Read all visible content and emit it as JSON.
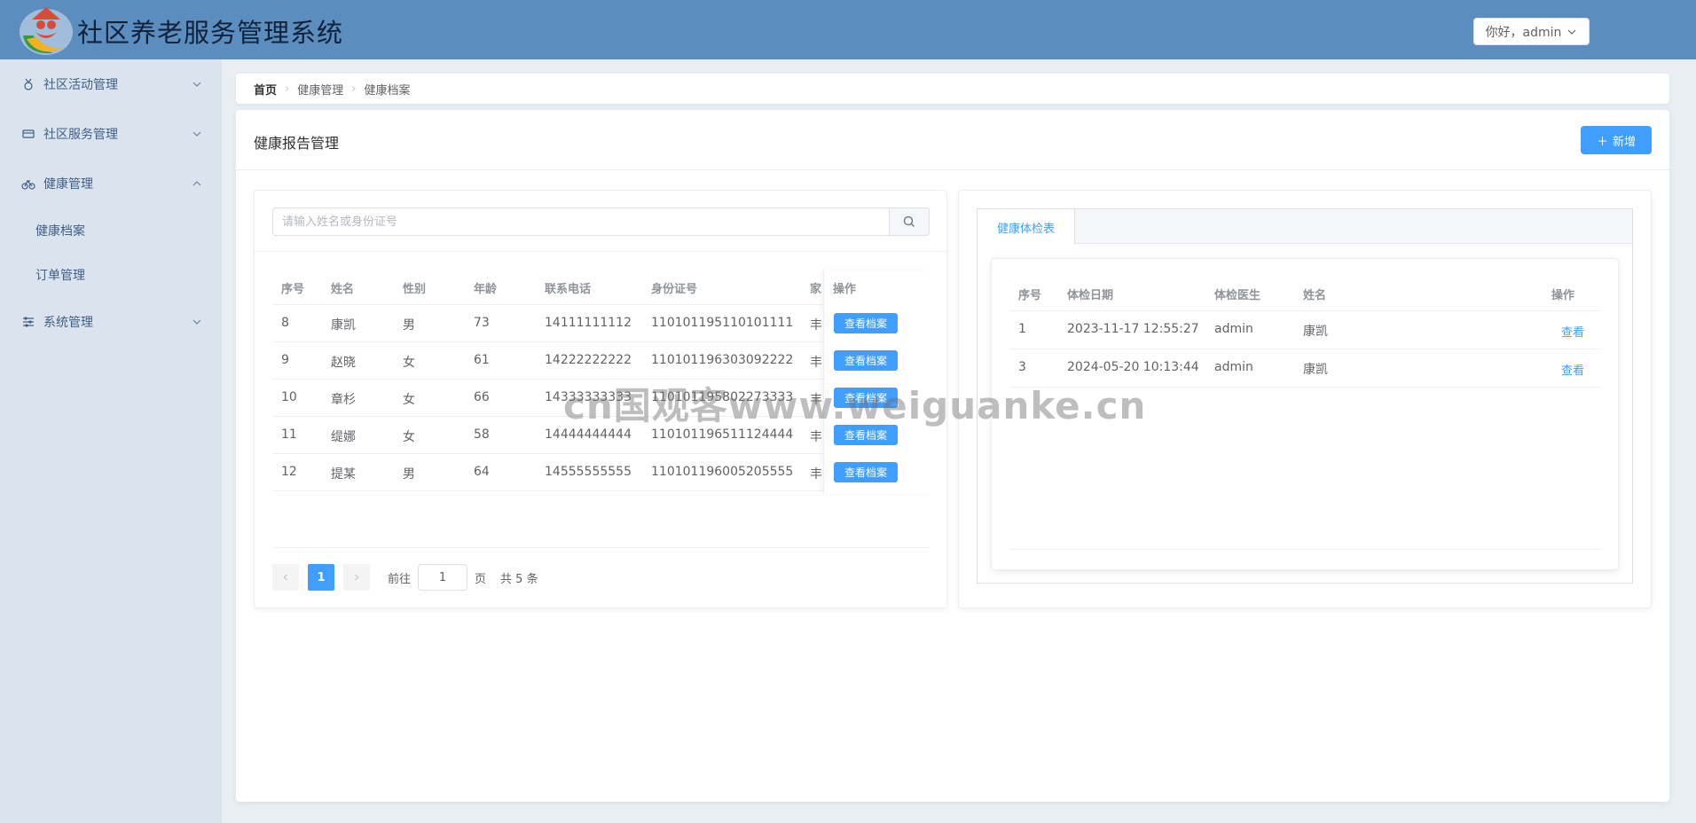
{
  "header": {
    "title": "社区养老服务管理系统",
    "user_label": "你好，admin"
  },
  "sidebar": {
    "items": [
      {
        "label": "社区活动管理",
        "icon": "medal-icon",
        "expanded": false
      },
      {
        "label": "社区服务管理",
        "icon": "service-icon",
        "expanded": false
      },
      {
        "label": "健康管理",
        "icon": "bike-icon",
        "expanded": true
      },
      {
        "label": "系统管理",
        "icon": "sliders-icon",
        "expanded": false
      }
    ],
    "sub_items": [
      {
        "label": "健康档案"
      },
      {
        "label": "订单管理"
      }
    ]
  },
  "breadcrumb": [
    "首页",
    "健康管理",
    "健康档案"
  ],
  "card": {
    "title": "健康报告管理",
    "add_label": "新增"
  },
  "search": {
    "placeholder": "请输入姓名或身份证号"
  },
  "table": {
    "columns": [
      "序号",
      "姓名",
      "性别",
      "年龄",
      "联系电话",
      "身份证号",
      "家",
      "操作"
    ],
    "action_label": "查看档案",
    "rows": [
      {
        "no": "8",
        "name": "康凯",
        "gender": "男",
        "age": "73",
        "phone": "14111111112",
        "id": "110101195110101111",
        "addr": "丰"
      },
      {
        "no": "9",
        "name": "赵晓",
        "gender": "女",
        "age": "61",
        "phone": "14222222222",
        "id": "110101196303092222",
        "addr": "丰"
      },
      {
        "no": "10",
        "name": "章杉",
        "gender": "女",
        "age": "66",
        "phone": "14333333333",
        "id": "110101195802273333",
        "addr": "丰"
      },
      {
        "no": "11",
        "name": "缇娜",
        "gender": "女",
        "age": "58",
        "phone": "14444444444",
        "id": "110101196511124444",
        "addr": "丰"
      },
      {
        "no": "12",
        "name": "提某",
        "gender": "男",
        "age": "64",
        "phone": "14555555555",
        "id": "110101196005205555",
        "addr": "丰"
      }
    ]
  },
  "pagination": {
    "current": "1",
    "goto_prefix": "前往",
    "goto_value": "1",
    "goto_suffix": "页",
    "total_text": "共 5 条"
  },
  "right": {
    "tab_label": "健康体检表",
    "columns": [
      "序号",
      "体检日期",
      "体检医生",
      "姓名",
      "操作"
    ],
    "action_label": "查看",
    "rows": [
      {
        "no": "1",
        "date": "2023-11-17 12:55:27",
        "doctor": "admin",
        "name": "康凯"
      },
      {
        "no": "3",
        "date": "2024-05-20 10:13:44",
        "doctor": "admin",
        "name": "康凯"
      }
    ]
  },
  "watermark": "cn国观客www.weiguanke.cn",
  "colors": {
    "header_bg": "#5b8dbe",
    "sidebar_bg": "#dbe4ee",
    "primary": "#409eff"
  }
}
